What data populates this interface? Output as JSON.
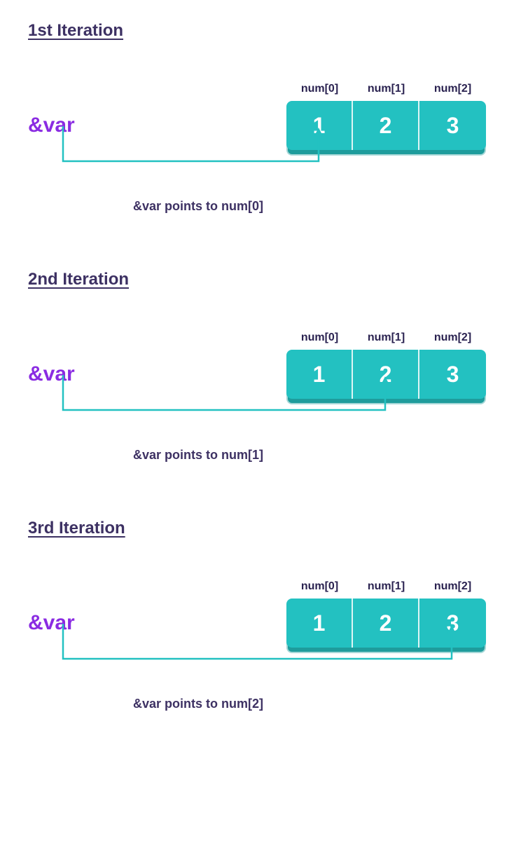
{
  "iterations": [
    {
      "title": "1st Iteration",
      "var": "&var",
      "labels": [
        "num[0]",
        "num[1]",
        "num[2]"
      ],
      "values": [
        "1",
        "2",
        "3"
      ],
      "caption": "&var points to num[0]",
      "targetIndex": 0
    },
    {
      "title": "2nd Iteration",
      "var": "&var",
      "labels": [
        "num[0]",
        "num[1]",
        "num[2]"
      ],
      "values": [
        "1",
        "2",
        "3"
      ],
      "caption": "&var points to num[1]",
      "targetIndex": 1
    },
    {
      "title": "3rd Iteration",
      "var": "&var",
      "labels": [
        "num[0]",
        "num[1]",
        "num[2]"
      ],
      "values": [
        "1",
        "2",
        "3"
      ],
      "caption": "&var points to num[2]",
      "targetIndex": 2
    }
  ],
  "colors": {
    "accent": "#23c1c1",
    "varColor": "#8a2be2",
    "text": "#3d3163"
  }
}
